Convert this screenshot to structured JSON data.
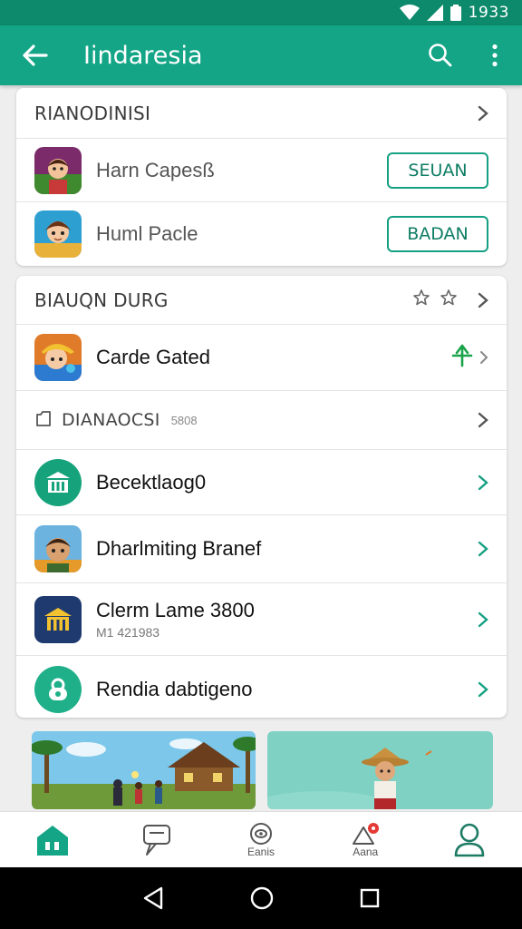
{
  "status": {
    "time": "1933",
    "icons": [
      "wifi-icon",
      "signal-icon",
      "battery-icon"
    ]
  },
  "app_bar": {
    "title": "Iindaresia",
    "accent": "#13a586"
  },
  "section1": {
    "header": "RIANODINISI",
    "items": [
      {
        "label": "Harn Capesß",
        "button": "SEUAN"
      },
      {
        "label": "Huml Pacle",
        "button": "BADAN"
      }
    ]
  },
  "section2": {
    "header": "BIAUQN DURG",
    "featured": {
      "label": "Carde Gated"
    },
    "subheader": {
      "label": "DIANAOCSI",
      "meta": "5808"
    },
    "items": [
      {
        "label": "Becektlaog0"
      },
      {
        "label": "Dharlmiting Branef"
      },
      {
        "label": "Clerm Lame 3800",
        "sub": "M1 421983"
      },
      {
        "label": "Rendia dabtigeno"
      }
    ]
  },
  "bottom_nav": [
    {
      "icon": "home-icon",
      "label": ""
    },
    {
      "icon": "chat-icon",
      "label": ""
    },
    {
      "icon": "eye-icon",
      "label": "Eanis"
    },
    {
      "icon": "bell-icon",
      "label": "Aana"
    },
    {
      "icon": "profile-icon",
      "label": ""
    }
  ]
}
